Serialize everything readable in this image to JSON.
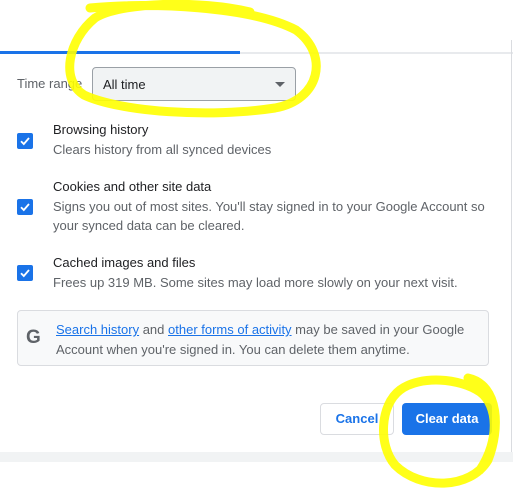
{
  "time_range": {
    "label": "Time range",
    "selected": "All time"
  },
  "options": [
    {
      "title": "Browsing history",
      "description": "Clears history from all synced devices",
      "checked": true
    },
    {
      "title": "Cookies and other site data",
      "description": "Signs you out of most sites. You'll stay signed in to your Google Account so your synced data can be cleared.",
      "checked": true
    },
    {
      "title": "Cached images and files",
      "description": "Frees up 319 MB. Some sites may load more slowly on your next visit.",
      "checked": true
    }
  ],
  "info": {
    "icon": "google-g-icon",
    "link1": "Search history",
    "middle": " and ",
    "link2": "other forms of activity",
    "rest": " may be saved in your Google Account when you're signed in. You can delete them anytime."
  },
  "buttons": {
    "cancel": "Cancel",
    "clear": "Clear data"
  },
  "colors": {
    "accent": "#1a73e8",
    "highlight": "#ffff00"
  }
}
